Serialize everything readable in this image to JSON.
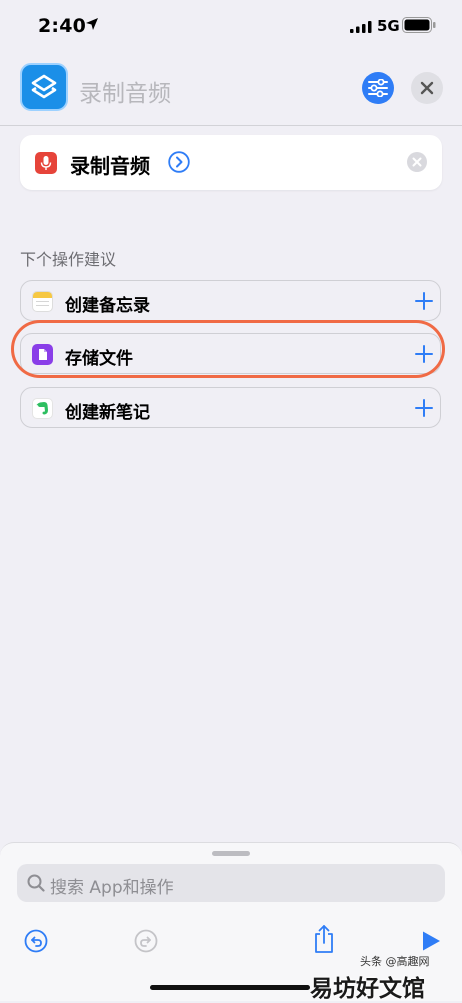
{
  "status_bar": {
    "time": "2:40",
    "network": "5G"
  },
  "header": {
    "title": "录制音频"
  },
  "action": {
    "name": "录制音频"
  },
  "suggestions": {
    "title": "下个操作建议",
    "items": [
      {
        "label": "创建备忘录",
        "icon": "notes-icon"
      },
      {
        "label": "存储文件",
        "icon": "files-icon"
      },
      {
        "label": "创建新笔记",
        "icon": "evernote-icon"
      }
    ]
  },
  "search": {
    "placeholder": "搜索 App和操作"
  },
  "watermark": {
    "text": "易坊好文馆",
    "small": "头条 @高趣网"
  },
  "colors": {
    "accent": "#2f7df6",
    "highlight": "#f06a45",
    "mic": "#e6443a",
    "files": "#8a3ee8"
  }
}
